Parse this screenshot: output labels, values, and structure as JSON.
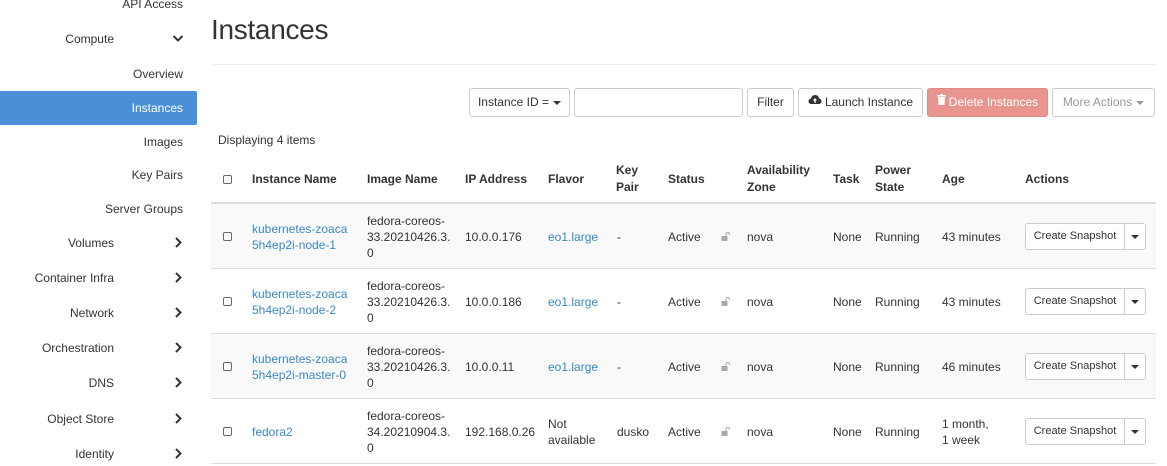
{
  "sidebar": {
    "api_access": "API Access",
    "compute": {
      "label": "Compute",
      "icon": "chevron-down-icon"
    },
    "compute_items": [
      {
        "label": "Overview",
        "active": false
      },
      {
        "label": "Instances",
        "active": true
      },
      {
        "label": "Images",
        "active": false
      },
      {
        "label": "Key Pairs",
        "active": false
      },
      {
        "label": "Server Groups",
        "active": false
      }
    ],
    "sections": [
      {
        "label": "Volumes",
        "icon": "chevron-right-icon"
      },
      {
        "label": "Container Infra",
        "icon": "chevron-right-icon"
      },
      {
        "label": "Network",
        "icon": "chevron-right-icon"
      },
      {
        "label": "Orchestration",
        "icon": "chevron-right-icon"
      },
      {
        "label": "DNS",
        "icon": "chevron-right-icon"
      },
      {
        "label": "Object Store",
        "icon": "chevron-right-icon"
      }
    ],
    "identity": {
      "label": "Identity",
      "icon": "chevron-right-icon"
    },
    "active_color": "#4A90D9"
  },
  "page": {
    "title": "Instances"
  },
  "toolbar": {
    "filter_field": "Instance ID =",
    "search_value": "",
    "filter_label": "Filter",
    "launch_label": "Launch Instance",
    "launch_icon": "cloud-upload-icon",
    "delete_label": "Delete Instances",
    "delete_icon": "trash-icon",
    "more_label": "More Actions",
    "danger_color": "#e8948f"
  },
  "table": {
    "display_count": "Displaying 4 items",
    "headers": {
      "instance_name": "Instance Name",
      "image_name": "Image Name",
      "ip_address": "IP Address",
      "flavor": "Flavor",
      "key_pair_1": "Key",
      "key_pair_2": "Pair",
      "status": "Status",
      "az_1": "Availability",
      "az_2": "Zone",
      "task": "Task",
      "power_1": "Power",
      "power_2": "State",
      "age": "Age",
      "actions": "Actions"
    },
    "rows": [
      {
        "name_1": "kubernetes-zoaca",
        "name_2": "5h4ep2i-node-1",
        "image_1": "fedora-coreos-",
        "image_2": "33.20210426.3.",
        "image_3": "0",
        "ip": "10.0.0.176",
        "flavor_1": "eo1.large",
        "flavor_2": "",
        "key_pair": "-",
        "status": "Active",
        "az": "nova",
        "task": "None",
        "power": "Running",
        "age_1": "43 minutes",
        "age_2": "",
        "action": "Create Snapshot"
      },
      {
        "name_1": "kubernetes-zoaca",
        "name_2": "5h4ep2i-node-2",
        "image_1": "fedora-coreos-",
        "image_2": "33.20210426.3.",
        "image_3": "0",
        "ip": "10.0.0.186",
        "flavor_1": "eo1.large",
        "flavor_2": "",
        "key_pair": "-",
        "status": "Active",
        "az": "nova",
        "task": "None",
        "power": "Running",
        "age_1": "43 minutes",
        "age_2": "",
        "action": "Create Snapshot"
      },
      {
        "name_1": "kubernetes-zoaca",
        "name_2": "5h4ep2i-master-0",
        "image_1": "fedora-coreos-",
        "image_2": "33.20210426.3.",
        "image_3": "0",
        "ip": "10.0.0.11",
        "flavor_1": "eo1.large",
        "flavor_2": "",
        "key_pair": "-",
        "status": "Active",
        "az": "nova",
        "task": "None",
        "power": "Running",
        "age_1": "46 minutes",
        "age_2": "",
        "action": "Create Snapshot"
      },
      {
        "name_1": "fedora2",
        "name_2": "",
        "image_1": "fedora-coreos-",
        "image_2": "34.20210904.3.",
        "image_3": "0",
        "ip": "192.168.0.26",
        "flavor_1": "Not",
        "flavor_2": "available",
        "key_pair": "dusko",
        "status": "Active",
        "az": "nova",
        "task": "None",
        "power": "Running",
        "age_1": "1 month,",
        "age_2": "1 week",
        "action": "Create Snapshot"
      }
    ],
    "link_color": "#3a87c8"
  }
}
